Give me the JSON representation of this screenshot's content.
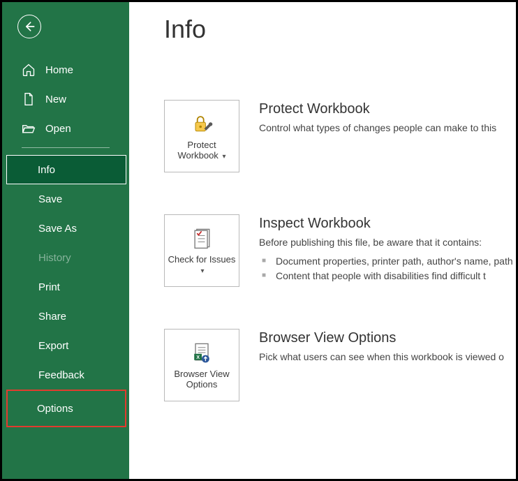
{
  "sidebar": {
    "items": [
      {
        "label": "Home"
      },
      {
        "label": "New"
      },
      {
        "label": "Open"
      },
      {
        "label": "Info"
      },
      {
        "label": "Save"
      },
      {
        "label": "Save As"
      },
      {
        "label": "History"
      },
      {
        "label": "Print"
      },
      {
        "label": "Share"
      },
      {
        "label": "Export"
      },
      {
        "label": "Feedback"
      },
      {
        "label": "Options"
      }
    ]
  },
  "page": {
    "title": "Info"
  },
  "sections": {
    "protect": {
      "tile_label": "Protect Workbook",
      "title": "Protect Workbook",
      "desc": "Control what types of changes people can make to this"
    },
    "inspect": {
      "tile_label": "Check for Issues",
      "title": "Inspect Workbook",
      "desc": "Before publishing this file, be aware that it contains:",
      "bullets": [
        "Document properties, printer path, author's name, path",
        "Content that people with disabilities find difficult t"
      ]
    },
    "browser": {
      "tile_label": "Browser View Options",
      "title": "Browser View Options",
      "desc": "Pick what users can see when this workbook is viewed o"
    }
  }
}
